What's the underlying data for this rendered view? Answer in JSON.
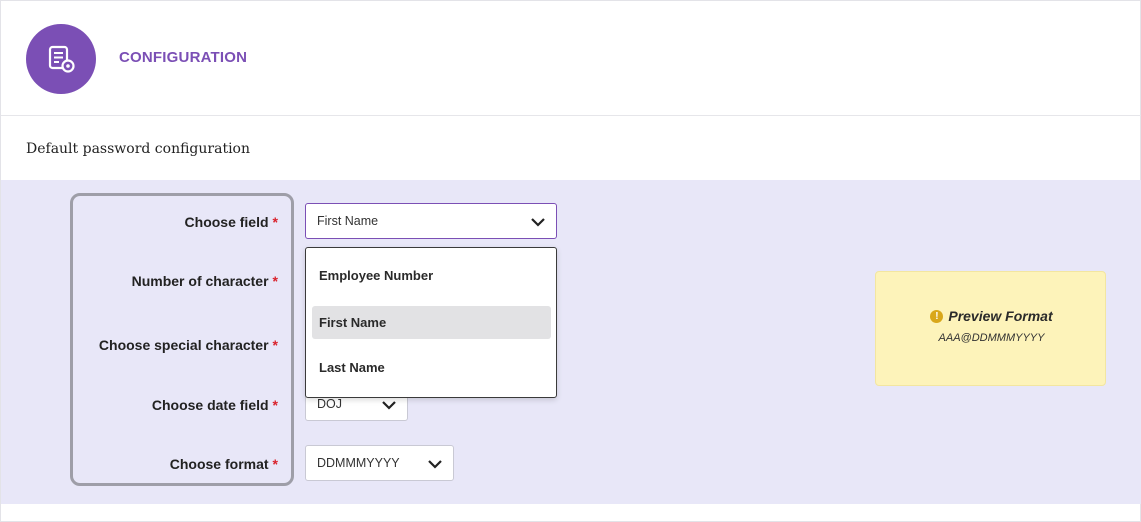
{
  "header": {
    "title": "CONFIGURATION",
    "icon": "settings-list-icon"
  },
  "section": {
    "title": "Default password configuration"
  },
  "form": {
    "required_mark": "*",
    "choose_field": {
      "label": "Choose field",
      "value": "First Name"
    },
    "number_of_character": {
      "label": "Number of character"
    },
    "choose_special_character": {
      "label": "Choose special character"
    },
    "choose_date_field": {
      "label": "Choose date field",
      "value": "DOJ"
    },
    "choose_format": {
      "label": "Choose format",
      "value": "DDMMMYYYY"
    }
  },
  "dropdown": {
    "options": [
      "Employee Number",
      "First Name",
      "Last Name"
    ],
    "selected": "First Name"
  },
  "preview": {
    "title": "Preview Format",
    "value": "AAA@DDMMMYYYY",
    "icon": "info-icon"
  },
  "colors": {
    "accent": "#7b4fb5",
    "form_background": "#e8e7f8",
    "required": "#d9232d",
    "preview_background": "#fdf3ba"
  }
}
